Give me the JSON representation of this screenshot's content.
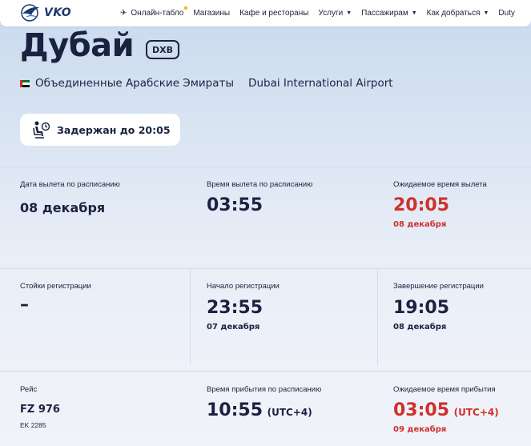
{
  "header": {
    "logo_text": "VKO",
    "nav": [
      {
        "label": "Онлайн-табло",
        "has_dot": true
      },
      {
        "label": "Магазины"
      },
      {
        "label": "Кафе и рестораны"
      },
      {
        "label": "Услуги",
        "dropdown": true
      },
      {
        "label": "Пассажирам",
        "dropdown": true
      },
      {
        "label": "Как добраться",
        "dropdown": true
      },
      {
        "label": "Duty"
      }
    ]
  },
  "destination": {
    "city": "Дубай",
    "code": "DXB",
    "country": "Объединенные Арабские Эмираты",
    "airport": "Dubai International Airport"
  },
  "status": {
    "text": "Задержан до 20:05"
  },
  "info": {
    "departure_date_label": "Дата вылета по расписанию",
    "departure_date": "08 декабря",
    "departure_time_label": "Время вылета по расписанию",
    "departure_time": "03:55",
    "expected_departure_label": "Ожидаемое время вылета",
    "expected_departure_time": "20:05",
    "expected_departure_date": "08 декабря",
    "checkin_desks_label": "Стойки регистрации",
    "checkin_desks": "–",
    "checkin_start_label": "Начало регистрации",
    "checkin_start_time": "23:55",
    "checkin_start_date": "07 декабря",
    "checkin_end_label": "Завершение регистрации",
    "checkin_end_time": "19:05",
    "checkin_end_date": "08 декабря",
    "flight_label": "Рейс",
    "flight_number": "FZ 976",
    "codeshare": "EK 2285",
    "arrival_label": "Время прибытия по расписанию",
    "arrival_time": "10:55",
    "arrival_tz": "(UTC+4)",
    "expected_arrival_label": "Ожидаемое время прибытия",
    "expected_arrival_time": "03:05",
    "expected_arrival_tz": "(UTC+4)",
    "expected_arrival_date": "09 декабря"
  },
  "colors": {
    "text": "#1b2240",
    "delay_red": "#d0302b",
    "accent_yellow": "#f5b400",
    "logo_blue": "#1b3a6e"
  }
}
